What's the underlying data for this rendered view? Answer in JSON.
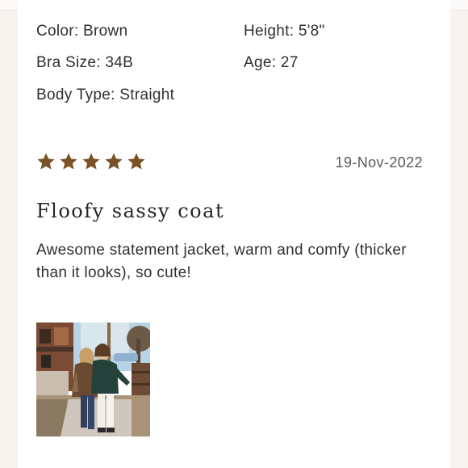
{
  "reviewer": {
    "color": "Color: Brown",
    "height": "Height: 5'8\"",
    "bra_size": "Bra Size: 34B",
    "age": "Age: 27",
    "body_type": "Body Type: Straight"
  },
  "review": {
    "rating": 5,
    "rating_max": 5,
    "date": "19-Nov-2022",
    "title": "Floofy sassy coat",
    "text": "Awesome statement jacket, warm and comfy (thicker than it looks), so cute!"
  },
  "photo": {
    "icon": "review-photo-thumbnail"
  },
  "colors": {
    "star": "#7a5226",
    "background": "#f7f3ef",
    "card": "#ffffff"
  }
}
